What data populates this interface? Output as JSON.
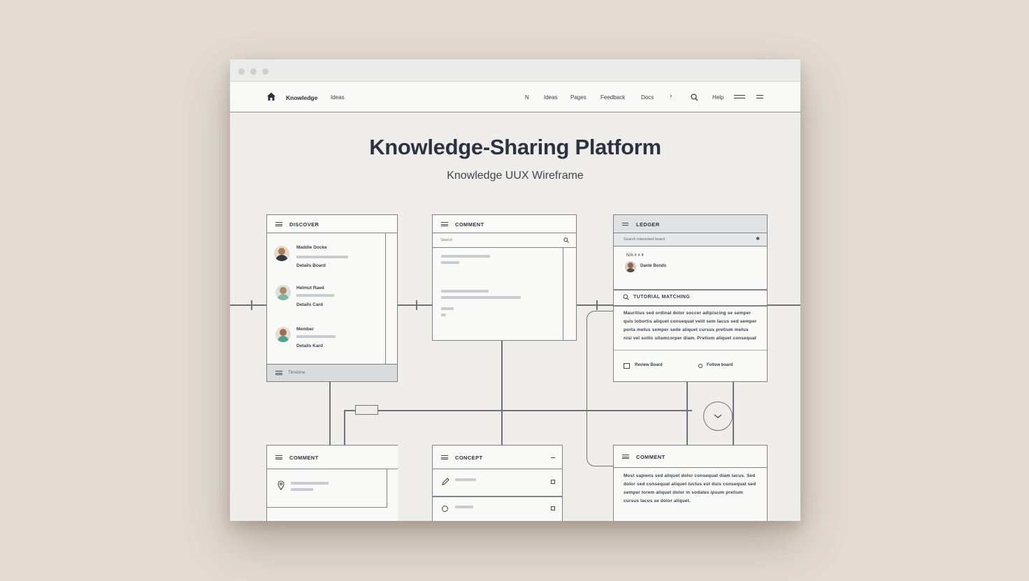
{
  "window": {
    "title": ""
  },
  "navbar": {
    "brand": "Knowledge",
    "brand_sub": "Ideas",
    "links": [
      "N",
      "Ideas",
      "Pages",
      "Feedback",
      "Docs",
      "›",
      "Help"
    ]
  },
  "hero": {
    "title": "Knowledge-Sharing Platform",
    "subtitle": "Knowledge UUX Wireframe"
  },
  "cards": {
    "discover": {
      "title": "Discover",
      "users": [
        {
          "name": "Maddie Docke",
          "meta": "Details Board"
        },
        {
          "name": "Helmut Raed",
          "meta": "Details Card"
        },
        {
          "name": "Member",
          "meta": "Details Kard"
        }
      ],
      "footer": "Timeline"
    },
    "comment_top": {
      "title": "Comment",
      "search_placeholder": "Search"
    },
    "ledger": {
      "title": "Ledger",
      "search_placeholder": "Search    Interested board",
      "meta": "N/A  #  #  4",
      "user": "Dante Bonds",
      "section_title": "Tutorial Matching",
      "paragraph": "Mauritius sed ordinal dolor soccer adipiscing se semper quis lobortis aliquet consequat velit sem lacus sed semper porta metus semper sede aliquet cursus pretium metus nisi vel sollic ullamcorper diam. Pretium aliquet consequat tempus adipiscing sed sodales sed semper lacus.",
      "action_save": "Review Board",
      "action_share": "Follow board"
    },
    "comment_bottom_left": {
      "title": "Comment"
    },
    "concept": {
      "title": "Concept"
    },
    "comment_bottom_right": {
      "title": "Comment",
      "paragraph": "Most sapiens sed aliquet dolor consequat diam lacus. Sed dolor sed consequat aliquet luctus est duis consequat sed semper lorem aliquet dolor in sodales ipsum pretium cursus lacus se dolor aliquet."
    }
  }
}
